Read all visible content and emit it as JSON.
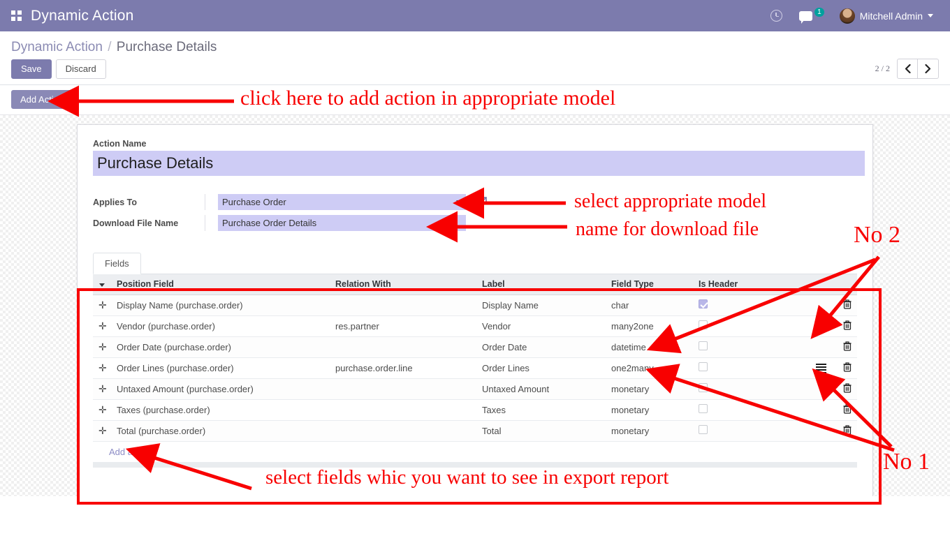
{
  "navbar": {
    "apps_icon": "apps-grid-icon",
    "brand": "Dynamic Action",
    "activity_icon": "clock-icon",
    "messages_icon": "chat-bubble-icon",
    "messages_count": "1",
    "user_name": "Mitchell Admin",
    "caret_icon": "chevron-down-icon",
    "accent_color": "#7c7bad",
    "badge_color": "#00a09d"
  },
  "control_panel": {
    "breadcrumb_root": "Dynamic Action",
    "breadcrumb_sep": "/",
    "breadcrumb_current": "Purchase Details",
    "save_label": "Save",
    "discard_label": "Discard",
    "pager_text": "2 / 2",
    "prev_icon": "chevron-left-icon",
    "next_icon": "chevron-right-icon"
  },
  "action_bar": {
    "add_action_label": "Add Action"
  },
  "form": {
    "action_name_label": "Action Name",
    "action_name_value": "Purchase Details",
    "applies_to_label": "Applies To",
    "applies_to_value": "Purchase Order",
    "applies_to_dropdown_icon": "chevron-down-icon",
    "applies_to_external_icon": "external-link-icon",
    "download_file_label": "Download File Name",
    "download_file_value": "Purchase Order Details"
  },
  "notebook": {
    "tabs": [
      {
        "label": "Fields"
      }
    ]
  },
  "fields_table": {
    "columns": [
      "Position Field",
      "Relation With",
      "Label",
      "Field Type",
      "Is Header",
      ""
    ],
    "sort_indicator": "caret-down-icon",
    "rows": [
      {
        "handle": "drag-handle-icon",
        "position_field": "Display Name (purchase.order)",
        "relation_with": "",
        "label": "Display Name",
        "field_type": "char",
        "is_header": true,
        "has_list_icon": false,
        "delete_icon": "trash-icon"
      },
      {
        "handle": "drag-handle-icon",
        "position_field": "Vendor (purchase.order)",
        "relation_with": "res.partner",
        "label": "Vendor",
        "field_type": "many2one",
        "is_header": false,
        "has_list_icon": true,
        "delete_icon": "trash-icon"
      },
      {
        "handle": "drag-handle-icon",
        "position_field": "Order Date (purchase.order)",
        "relation_with": "",
        "label": "Order Date",
        "field_type": "datetime",
        "is_header": false,
        "has_list_icon": false,
        "delete_icon": "trash-icon"
      },
      {
        "handle": "drag-handle-icon",
        "position_field": "Order Lines (purchase.order)",
        "relation_with": "purchase.order.line",
        "label": "Order Lines",
        "field_type": "one2many",
        "is_header": false,
        "has_list_icon": true,
        "delete_icon": "trash-icon"
      },
      {
        "handle": "drag-handle-icon",
        "position_field": "Untaxed Amount (purchase.order)",
        "relation_with": "",
        "label": "Untaxed Amount",
        "field_type": "monetary",
        "is_header": false,
        "has_list_icon": false,
        "delete_icon": "trash-icon"
      },
      {
        "handle": "drag-handle-icon",
        "position_field": "Taxes (purchase.order)",
        "relation_with": "",
        "label": "Taxes",
        "field_type": "monetary",
        "is_header": false,
        "has_list_icon": false,
        "delete_icon": "trash-icon"
      },
      {
        "handle": "drag-handle-icon",
        "position_field": "Total (purchase.order)",
        "relation_with": "",
        "label": "Total",
        "field_type": "monetary",
        "is_header": false,
        "has_list_icon": false,
        "delete_icon": "trash-icon"
      }
    ],
    "add_line_label": "Add a line"
  },
  "annotations": {
    "color": "#f80000",
    "add_action": "click here to add action in appropriate model",
    "select_model": "select appropriate model",
    "download_name": "name for download file",
    "no_two": "No 2",
    "no_one": "No 1",
    "select_fields": "select fields whic you want to see in export report"
  }
}
